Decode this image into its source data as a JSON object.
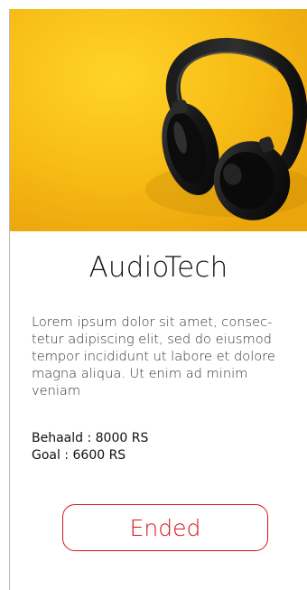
{
  "product": {
    "name": "AudioTech",
    "image_icon": "headphones-photo",
    "description": "Lorem ipsum dolor sit amet, consec­tetur adipiscing elit, sed do eiusmod tempor incididunt ut labore et dolore magna aliqua. Ut enim ad minim veniam",
    "stats": {
      "behaald": "Behaald : 8000 RS",
      "goal": "Goal : 6600 RS"
    }
  },
  "actions": {
    "status_label": "Ended"
  },
  "colors": {
    "hero_background": "#f6b914",
    "accent": "#d6141c",
    "title_text": "#111111",
    "body_text": "#333333"
  }
}
